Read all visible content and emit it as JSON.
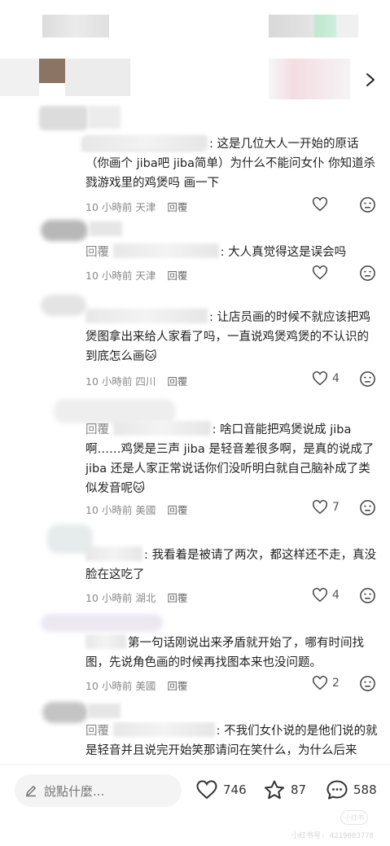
{
  "comments": [
    {
      "prefix": "",
      "text_after": ": 这是几位大人一开始的原话（你画个 jiba吧 jiba简单）为什么不能问女仆 你知道杀戮游戏里的鸡煲吗 画一下",
      "time": "10 小時前",
      "location": "天津",
      "reply": "回覆",
      "likes": ""
    },
    {
      "prefix": "回覆",
      "text_after": ": 大人真觉得这是误会吗",
      "time": "10 小時前",
      "location": "天津",
      "reply": "回覆",
      "likes": ""
    },
    {
      "prefix": "",
      "text_after": ": 让店员画的时候不就应该把鸡煲图拿出来给人家看了吗，一直说鸡煲鸡煲的不认识的到底怎么画🐱",
      "time": "10 小時前",
      "location": "四川",
      "reply": "回覆",
      "likes": "4"
    },
    {
      "prefix": "回覆",
      "text_after": ": 啥口音能把鸡煲说成 jiba 啊……鸡煲是三声 jiba 是轻音差很多啊，是真的说成了 jiba 还是人家正常说话你们没听明白就自己脑补成了类似发音呢🐱",
      "time": "10 小時前",
      "location": "美國",
      "reply": "回覆",
      "likes": "7"
    },
    {
      "prefix": "",
      "text_after": ": 我看着是被请了两次，都这样还不走，真没脸在这吃了",
      "time": "10 小時前",
      "location": "湖北",
      "reply": "回覆",
      "likes": "4"
    },
    {
      "prefix": "",
      "text_after": "第一句话刚说出来矛盾就开始了，哪有时间找图，先说角色画的时候再找图本来也没问题。",
      "time": "10 小時前",
      "location": "美國",
      "reply": "回覆",
      "likes": "2"
    },
    {
      "prefix": "回覆",
      "text_after": ": 不我们女仆说的是他们说的就是轻音并且说完开始笑那请问在笑什么，为什么后来",
      "time": "",
      "location": "",
      "reply": "",
      "likes": ""
    }
  ],
  "bottom_bar": {
    "input_placeholder": "說點什麼...",
    "likes_count": "746",
    "stars_count": "87",
    "comments_count": "588"
  },
  "watermark": {
    "badge": "小红书",
    "id": "小红书号: 4219003778"
  }
}
